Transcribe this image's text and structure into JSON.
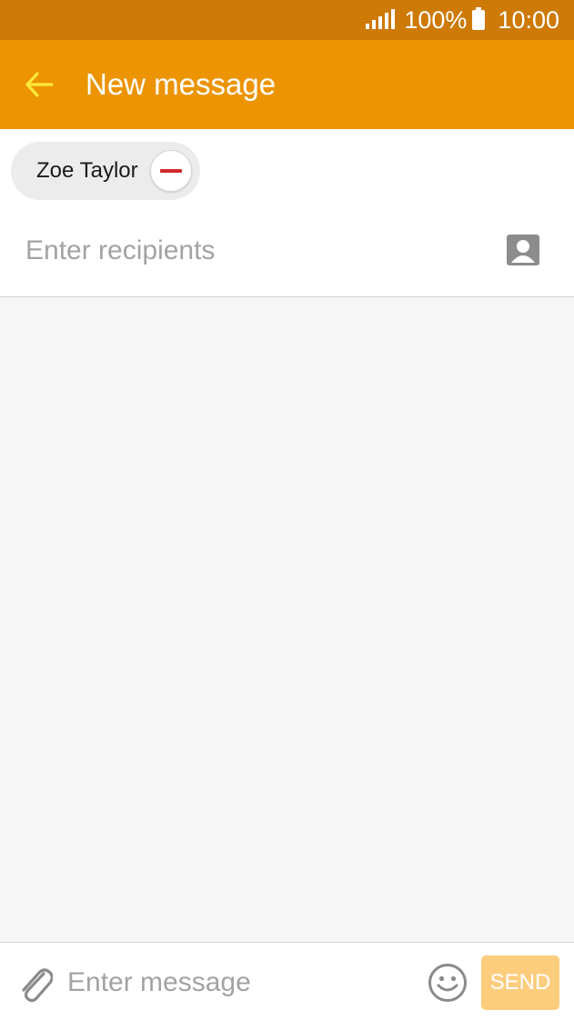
{
  "status_bar": {
    "battery_percent": "100%",
    "time": "10:00",
    "icons": [
      "signal-icon",
      "battery-icon"
    ]
  },
  "app_bar": {
    "title": "New message",
    "back_icon": "arrow-back-icon"
  },
  "recipients": {
    "chips": [
      {
        "name": "Zoe Taylor",
        "remove_icon": "minus-circle-icon"
      }
    ],
    "input_placeholder": "Enter recipients",
    "contact_icon": "contact-book-icon"
  },
  "composer": {
    "attach_icon": "paperclip-icon",
    "message_placeholder": "Enter message",
    "emoji_icon": "smiley-icon",
    "send_label": "SEND"
  },
  "colors": {
    "status_bar": "#cd7a06",
    "app_bar": "#ec9402",
    "back_arrow": "#ffe93a",
    "send_button": "#fdcd7e",
    "remove_icon": "#d12b2b"
  }
}
